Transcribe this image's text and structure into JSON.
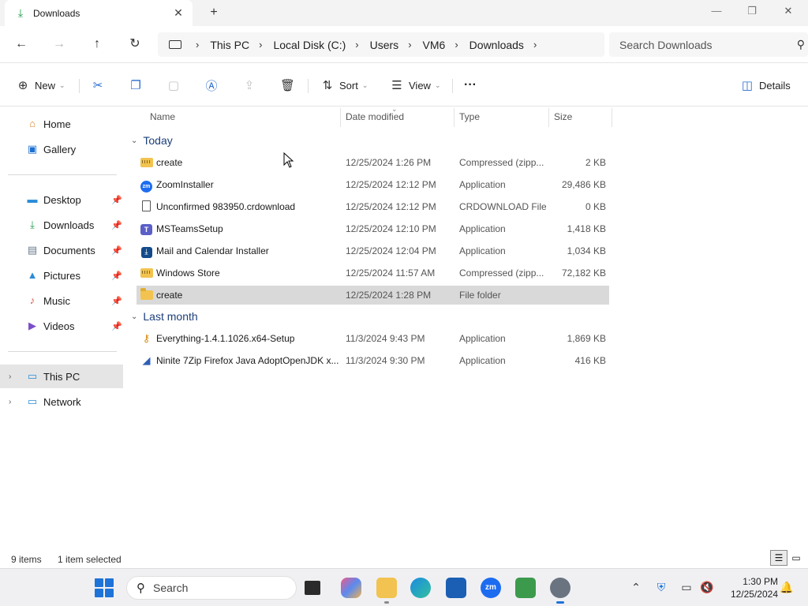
{
  "window": {
    "tab_title": "Downloads",
    "tab_close": "✕",
    "new_tab": "+",
    "minimize": "—",
    "maximize": "❐",
    "close": "✕"
  },
  "address": {
    "back": "←",
    "forward": "→",
    "up": "↑",
    "refresh": "↻",
    "breadcrumbs": [
      "This PC",
      "Local Disk (C:)",
      "Users",
      "VM6",
      "Downloads"
    ],
    "search_placeholder": "Search Downloads"
  },
  "commands": {
    "new_label": "New",
    "sort_label": "Sort",
    "view_label": "View",
    "more_label": "···",
    "details_label": "Details"
  },
  "nav": {
    "home": "Home",
    "gallery": "Gallery",
    "desktop": "Desktop",
    "downloads": "Downloads",
    "documents": "Documents",
    "pictures": "Pictures",
    "music": "Music",
    "videos": "Videos",
    "this_pc": "This PC",
    "network": "Network"
  },
  "columns": {
    "name": "Name",
    "date": "Date modified",
    "type": "Type",
    "size": "Size"
  },
  "groups": {
    "today": "Today",
    "last_month": "Last month"
  },
  "files": [
    {
      "name": "create",
      "date": "12/25/2024 1:26 PM",
      "type": "Compressed (zipp...",
      "size": "2 KB",
      "icon": "zip-folder-icon"
    },
    {
      "name": "ZoomInstaller",
      "date": "12/25/2024 12:12 PM",
      "type": "Application",
      "size": "29,486 KB",
      "icon": "zoom-icon"
    },
    {
      "name": "Unconfirmed 983950.crdownload",
      "date": "12/25/2024 12:12 PM",
      "type": "CRDOWNLOAD File",
      "size": "0 KB",
      "icon": "document-icon"
    },
    {
      "name": "MSTeamsSetup",
      "date": "12/25/2024 12:10 PM",
      "type": "Application",
      "size": "1,418 KB",
      "icon": "teams-icon"
    },
    {
      "name": "Mail and Calendar Installer",
      "date": "12/25/2024 12:04 PM",
      "type": "Application",
      "size": "1,034 KB",
      "icon": "mail-installer-icon"
    },
    {
      "name": "Windows Store",
      "date": "12/25/2024 11:57 AM",
      "type": "Compressed (zipp...",
      "size": "72,182 KB",
      "icon": "zip-folder-icon"
    },
    {
      "name": "create",
      "date": "12/25/2024 1:28 PM",
      "type": "File folder",
      "size": "",
      "icon": "folder-icon"
    },
    {
      "name": "Everything-1.4.1.1026.x64-Setup",
      "date": "11/3/2024 9:43 PM",
      "type": "Application",
      "size": "1,869 KB",
      "icon": "key-icon"
    },
    {
      "name": "Ninite 7Zip Firefox Java AdoptOpenJDK x...",
      "date": "11/3/2024 9:30 PM",
      "type": "Application",
      "size": "416 KB",
      "icon": "ninite-icon"
    }
  ],
  "status": {
    "items": "9 items",
    "selected": "1 item selected"
  },
  "taskbar": {
    "search_placeholder": "Search",
    "zoom_label": "zm",
    "time": "1:30 PM",
    "date": "12/25/2024"
  },
  "colors": {
    "accent": "#1e73d8",
    "selection": "#d9d9d9",
    "group_header": "#1c3f7a"
  }
}
